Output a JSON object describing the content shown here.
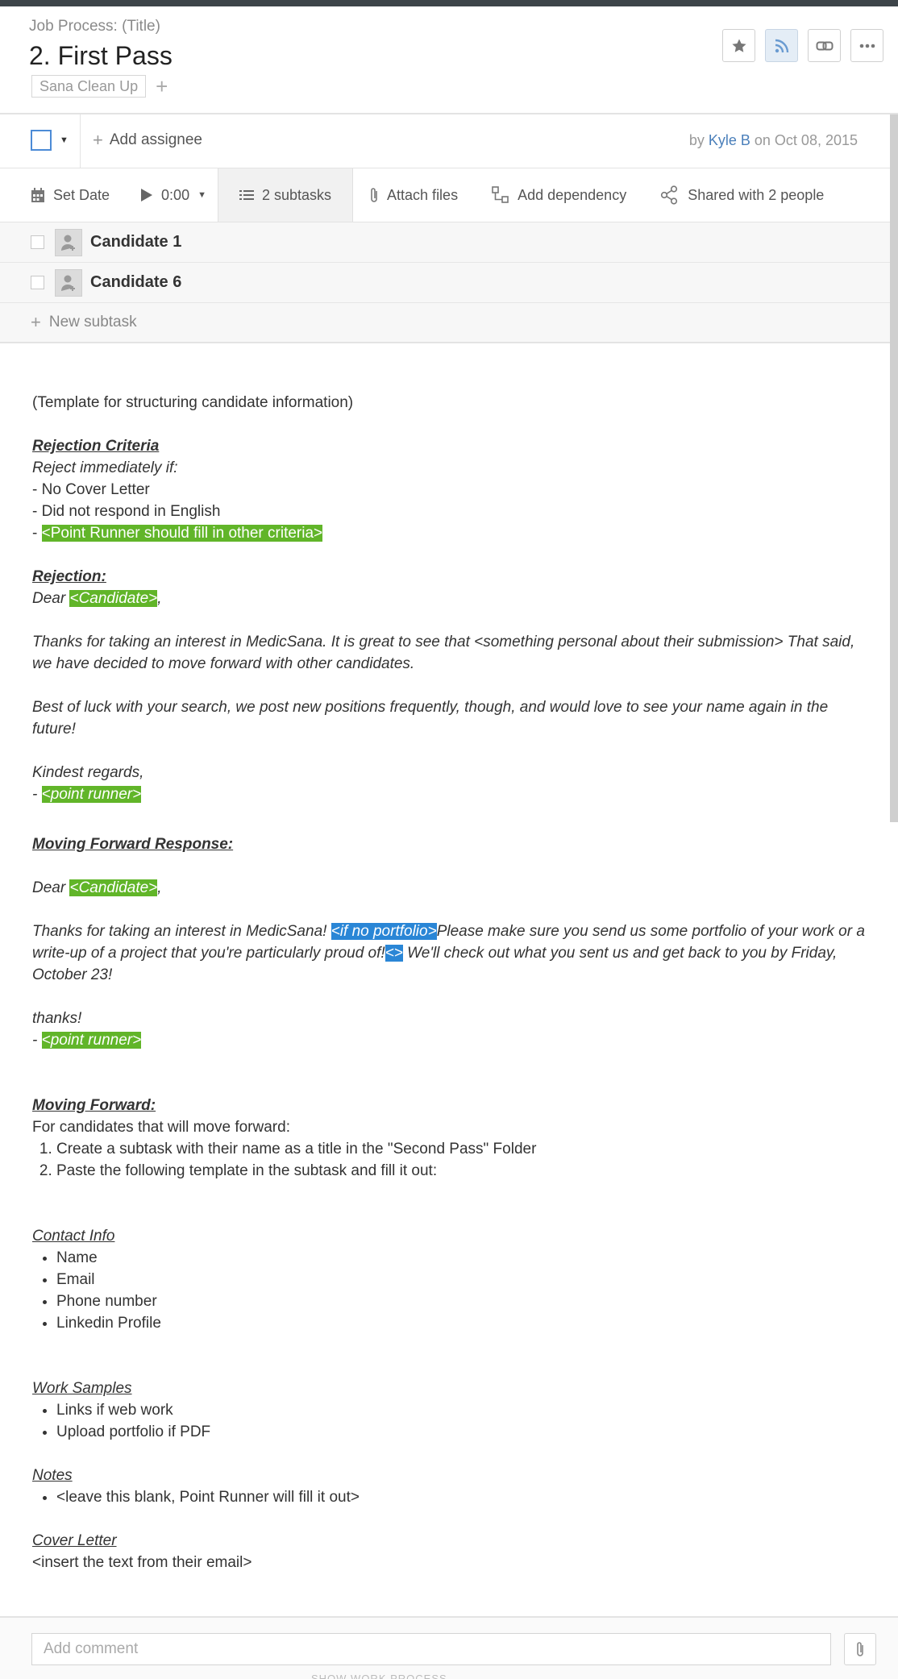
{
  "header": {
    "crumb": "Job Process: (Title)",
    "title": "2. First Pass",
    "tag": "Sana Clean Up",
    "add_tag": "+"
  },
  "header_buttons": [
    "star-icon",
    "rss-icon",
    "link-icon",
    "more-icon"
  ],
  "assign": {
    "add_assignee": "Add assignee",
    "by": "by",
    "author": "Kyle B",
    "on": "on Oct 08, 2015"
  },
  "toolbar": {
    "set_date": "Set Date",
    "timer": "0:00",
    "subtasks": "2 subtasks",
    "attach": "Attach files",
    "dependency": "Add dependency",
    "shared": "Shared with 2 people"
  },
  "subtasks": [
    {
      "name": "Candidate 1"
    },
    {
      "name": "Candidate 6"
    }
  ],
  "new_subtask": "New subtask",
  "content": {
    "intro": "(Template for structuring candidate information)",
    "rej_criteria_h": "Rejection Criteria",
    "reject_if": "Reject immediately if:",
    "c1": "- No Cover Letter",
    "c2": "- Did not respond in English",
    "c3_prefix": "- ",
    "c3_hl": "<Point Runner should fill in other criteria>",
    "rejection_h": "Rejection:",
    "dear": "Dear ",
    "candidate_hl": "<Candidate>",
    "comma": ",",
    "rej_p1": "Thanks for taking an interest in MedicSana. It is great to see that <something personal about their submission> That said, we have decided to move forward with other candidates.",
    "rej_p2": "Best of luck with your search, we post new positions frequently, though, and would love to see your name again in the future!",
    "kindest": "Kindest regards,",
    "dash": "- ",
    "point_runner_hl": "<point runner>",
    "mf_resp_h": "Moving Forward Response:",
    "mf_p1_a": "Thanks for taking an interest in MedicSana! ",
    "mf_p1_hl1": "<if no portfolio>",
    "mf_p1_b": "Please make sure you send us some portfolio of your work or a write-up of a project that you're particularly proud of!",
    "mf_p1_hl2": "<>",
    "mf_p1_c": " We'll check out what you sent us and get back to you by Friday, October 23!",
    "thanks": "thanks!",
    "mf_h": "Moving Forward:",
    "mf_intro": "For candidates that will move forward:",
    "mf_steps": [
      "Create a subtask with their name as a title in the \"Second Pass\" Folder",
      "Paste the following template in the subtask and fill it out:"
    ],
    "contact_h": "Contact Info",
    "contact_items": [
      "Name",
      "Email",
      "Phone number",
      "Linkedin Profile"
    ],
    "work_h": "Work Samples",
    "work_items": [
      "Links if web work",
      "Upload portfolio if PDF"
    ],
    "notes_h": "Notes",
    "notes_items": [
      "<leave this blank, Point Runner will fill it out>"
    ],
    "cover_h": "Cover Letter",
    "cover_text": "<insert the text from their email>"
  },
  "comment": {
    "placeholder": "Add comment",
    "footer": "SHOW WORK PROCESS"
  }
}
